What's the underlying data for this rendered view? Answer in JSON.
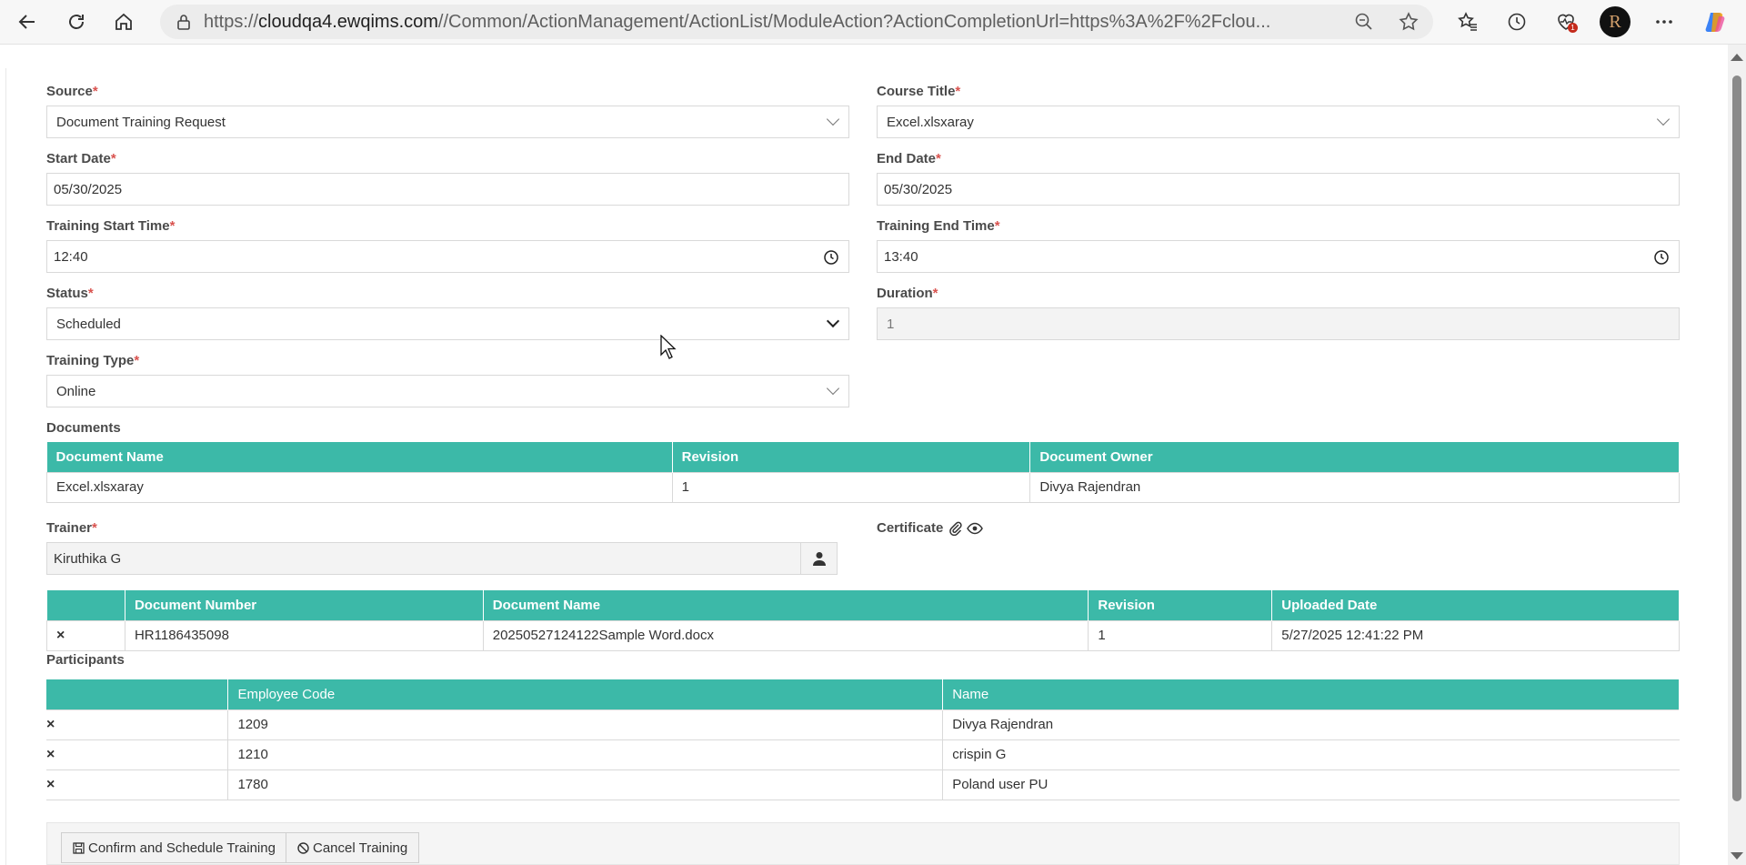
{
  "browser": {
    "url_prefix": "https://",
    "url_host": "cloudqa4.ewqims.com",
    "url_rest": "//Common/ActionManagement/ActionList/ModuleAction?ActionCompletionUrl=https%3A%2F%2Fclou...",
    "profile_initial": "R",
    "notification_count": "1"
  },
  "form": {
    "source": {
      "label": "Source",
      "value": "Document Training Request"
    },
    "course_title": {
      "label": "Course Title",
      "value": "Excel.xlsxaray"
    },
    "start_date": {
      "label": "Start Date",
      "value": "05/30/2025"
    },
    "end_date": {
      "label": "End Date",
      "value": "05/30/2025"
    },
    "training_start_time": {
      "label": "Training Start Time",
      "value": "12:40"
    },
    "training_end_time": {
      "label": "Training End Time",
      "value": "13:40"
    },
    "status": {
      "label": "Status",
      "value": "Scheduled"
    },
    "duration": {
      "label": "Duration",
      "value": "1"
    },
    "training_type": {
      "label": "Training Type",
      "value": "Online"
    },
    "required_mark": "*"
  },
  "documents": {
    "label": "Documents",
    "headers": [
      "Document Name",
      "Revision",
      "Document Owner"
    ],
    "rows": [
      [
        "Excel.xlsxaray",
        "1",
        "Divya Rajendran"
      ]
    ]
  },
  "trainer": {
    "label": "Trainer",
    "value": "Kiruthika G"
  },
  "certificate": {
    "label": "Certificate"
  },
  "certificates_table": {
    "headers": [
      "",
      "Document Number",
      "Document Name",
      "Revision",
      "Uploaded Date"
    ],
    "rows": [
      [
        "×",
        "HR1186435098",
        "20250527124122Sample Word.docx",
        "1",
        "5/27/2025 12:41:22 PM"
      ]
    ]
  },
  "participants": {
    "label": "Participants",
    "headers": [
      "",
      "Employee Code",
      "Name"
    ],
    "rows": [
      [
        "×",
        "1209",
        "Divya Rajendran"
      ],
      [
        "×",
        "1210",
        "crispin G"
      ],
      [
        "×",
        "1780",
        "Poland user PU"
      ]
    ]
  },
  "actions": {
    "confirm_label": "Confirm and Schedule Training",
    "cancel_label": "Cancel Training"
  },
  "colors": {
    "table_header": "#3cb9a8",
    "required": "#d9534f",
    "link": "#2e86c1"
  }
}
